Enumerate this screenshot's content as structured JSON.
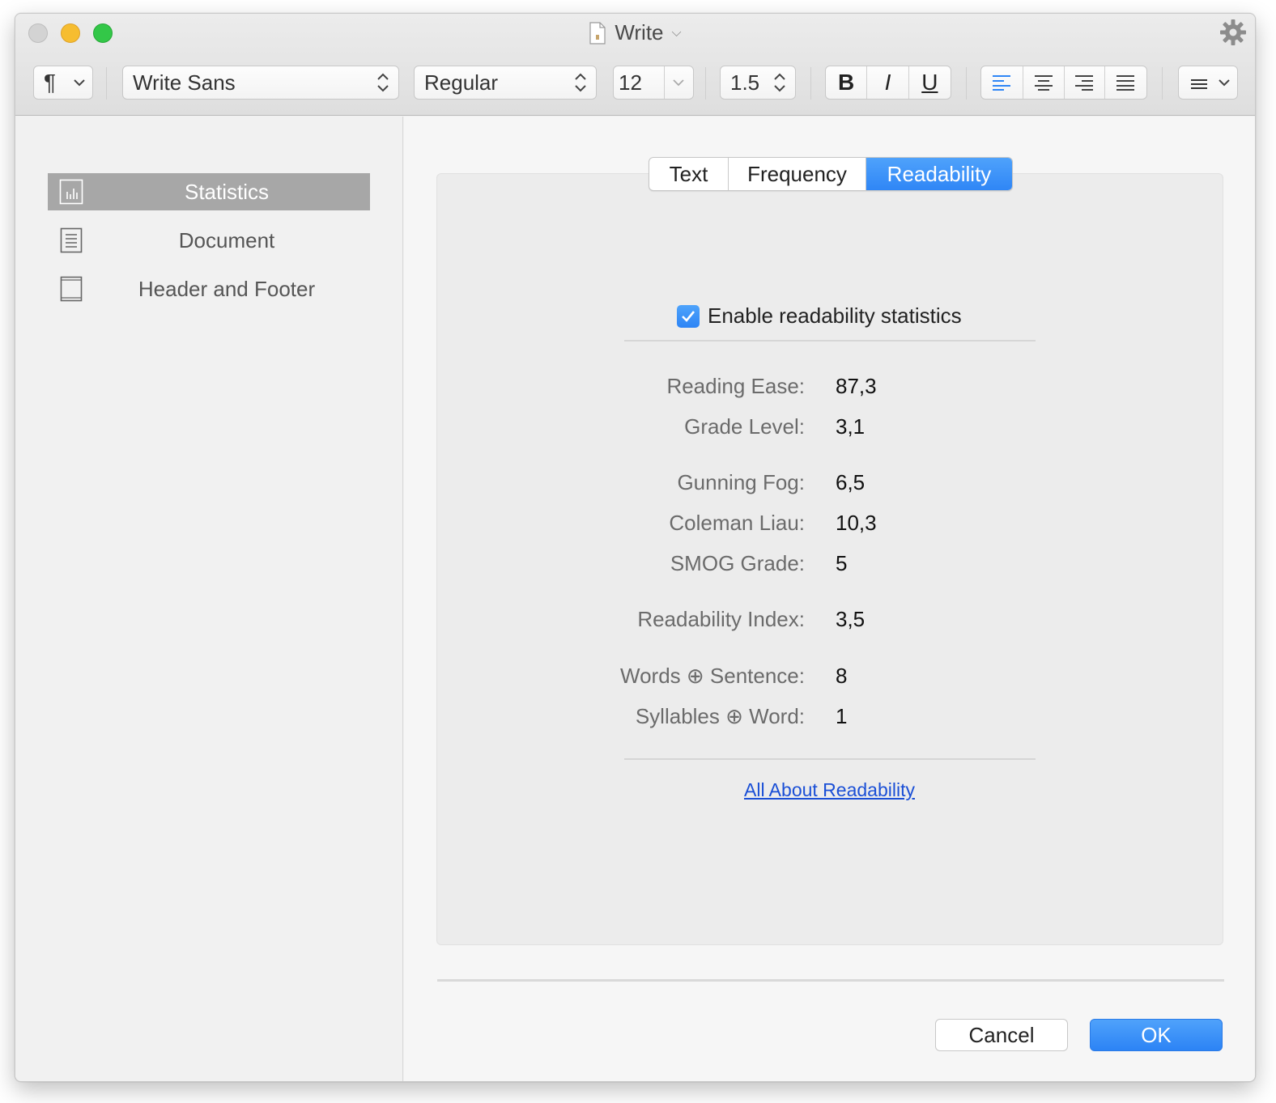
{
  "window": {
    "title": "Write"
  },
  "toolbar": {
    "paragraph_symbol": "¶",
    "font_family": "Write Sans",
    "font_style": "Regular",
    "font_size": "12",
    "line_spacing": "1.5",
    "bold": "B",
    "italic": "I",
    "underline": "U"
  },
  "sidebar": {
    "items": [
      {
        "label": "Statistics",
        "icon": "bar-chart-icon",
        "selected": true
      },
      {
        "label": "Document",
        "icon": "document-icon",
        "selected": false
      },
      {
        "label": "Header and Footer",
        "icon": "page-icon",
        "selected": false
      }
    ]
  },
  "tabs": [
    {
      "label": "Text",
      "active": false
    },
    {
      "label": "Frequency",
      "active": false
    },
    {
      "label": "Readability",
      "active": true
    }
  ],
  "readability": {
    "enable_label": "Enable readability statistics",
    "enabled": true,
    "stats": [
      {
        "label": "Reading Ease:",
        "value": "87,3"
      },
      {
        "label": "Grade Level:",
        "value": "3,1"
      },
      {
        "label": "Gunning Fog:",
        "value": "6,5"
      },
      {
        "label": "Coleman Liau:",
        "value": "10,3"
      },
      {
        "label": "SMOG Grade:",
        "value": "5"
      },
      {
        "label": "Readability Index:",
        "value": "3,5"
      },
      {
        "label": "Words ⊕ Sentence:",
        "value": "8"
      },
      {
        "label": "Syllables ⊕ Word:",
        "value": "1"
      }
    ],
    "link": "All About Readability"
  },
  "buttons": {
    "cancel": "Cancel",
    "ok": "OK"
  },
  "colors": {
    "accent": "#2f86f6",
    "selected_sidebar": "#a7a7a7",
    "link": "#1a4fd6"
  }
}
